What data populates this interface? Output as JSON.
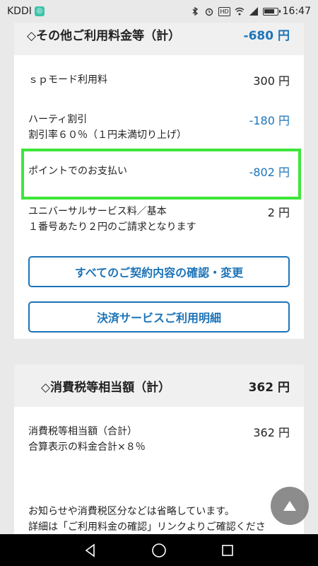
{
  "status_bar": {
    "carrier": "KDDI",
    "carrier_badge": "◎",
    "hd": "HD",
    "battery": "",
    "time": "16:47"
  },
  "other_section": {
    "title": "◇その他ご利用料金等（計）",
    "amount": "-680 円"
  },
  "rows": [
    {
      "label": "ｓｐモード利用料",
      "sub": "",
      "amount": "300 円"
    },
    {
      "label": "ハーティ割引",
      "sub": "割引率６０％（１円未満切り上げ）",
      "amount": "-180 円"
    },
    {
      "label": "ポイントでのお支払い",
      "sub": "",
      "amount": "-802 円"
    },
    {
      "label": "ユニバーサルサービス料／基本",
      "sub": "１番号あたり２円のご請求となります",
      "amount": "2 円"
    }
  ],
  "buttons": {
    "contract": "すべてのご契約内容の確認・変更",
    "payment": "決済サービスご利用明細"
  },
  "tax_section": {
    "title": "◇消費税等相当額（計）",
    "amount": "362 円",
    "row_label": "消費税等相当額（合計）",
    "row_sub": "合算表示の料金合計×８％",
    "row_amount": "362 円"
  },
  "notes": {
    "line1": "お知らせや消費税区分などは省略しています。",
    "line2": "詳細は「ご利用料金の確認」リンクよりご確認くださ"
  },
  "colors": {
    "accent": "#1d74b8",
    "highlight": "#3ee63a"
  }
}
